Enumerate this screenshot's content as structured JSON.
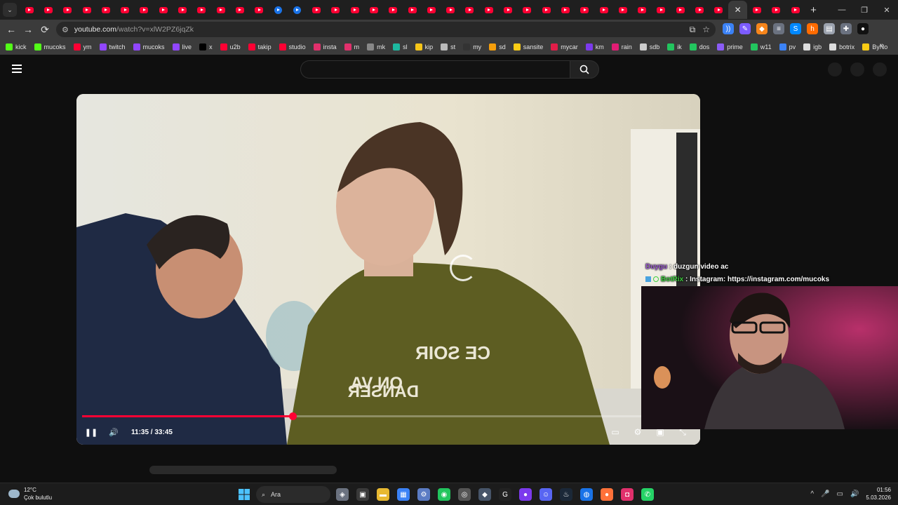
{
  "browser": {
    "tab_count": 41,
    "active_tab_index": 37,
    "blue_tab_indices": [
      13,
      14
    ],
    "close_glyph": "✕",
    "new_tab_glyph": "+",
    "window_controls": [
      "—",
      "❐",
      "✕"
    ],
    "nav": {
      "back": "←",
      "forward": "→",
      "reload": "⟳"
    },
    "url_host": "youtube.com",
    "url_path": "/watch?v=xlW2PZ6jqZk",
    "extensions": [
      {
        "icon": "audio-wave-icon",
        "glyph": "))",
        "color": "#3b82f6"
      },
      {
        "icon": "pen-icon",
        "glyph": "✎",
        "color": "#7c5cff"
      },
      {
        "icon": "metamask-icon",
        "glyph": "◆",
        "color": "#f6851b"
      },
      {
        "icon": "database-icon",
        "glyph": "≡",
        "color": "#6b7280"
      },
      {
        "icon": "shazam-icon",
        "glyph": "S",
        "color": "#0088ff"
      },
      {
        "icon": "honey-icon",
        "glyph": "h",
        "color": "#ff6b00"
      },
      {
        "icon": "wallet-icon",
        "glyph": "▤",
        "color": "#9ca3af"
      },
      {
        "icon": "puzzle-icon",
        "glyph": "✚",
        "color": "#6b7280"
      },
      {
        "icon": "profile-icon",
        "glyph": "●",
        "color": "#111111"
      }
    ]
  },
  "bookmarks": [
    {
      "label": "kick",
      "color": "#53fc18"
    },
    {
      "label": "mucoks",
      "color": "#53fc18"
    },
    {
      "label": "ym",
      "color": "#ff0033"
    },
    {
      "label": "twitch",
      "color": "#9146ff"
    },
    {
      "label": "mucoks",
      "color": "#9146ff"
    },
    {
      "label": "live",
      "color": "#9146ff"
    },
    {
      "label": "x",
      "color": "#000000"
    },
    {
      "label": "u2b",
      "color": "#ff0033"
    },
    {
      "label": "takip",
      "color": "#ff0033"
    },
    {
      "label": "studio",
      "color": "#ff0033"
    },
    {
      "label": "insta",
      "color": "#e1306c"
    },
    {
      "label": "m",
      "color": "#e1306c"
    },
    {
      "label": "mk",
      "color": "#888888"
    },
    {
      "label": "sl",
      "color": "#1db9a0"
    },
    {
      "label": "kip",
      "color": "#f5c518"
    },
    {
      "label": "st",
      "color": "#bbbbbb"
    },
    {
      "label": "my",
      "color": "#333333"
    },
    {
      "label": "sd",
      "color": "#f59e0b"
    },
    {
      "label": "sansite",
      "color": "#facc15"
    },
    {
      "label": "mycar",
      "color": "#e11d48"
    },
    {
      "label": "km",
      "color": "#7c3aed"
    },
    {
      "label": "rain",
      "color": "#e11d74"
    },
    {
      "label": "sdb",
      "color": "#cccccc"
    },
    {
      "label": "ik",
      "color": "#22c55e"
    },
    {
      "label": "dos",
      "color": "#22c55e"
    },
    {
      "label": "prime",
      "color": "#8b5cf6"
    },
    {
      "label": "w11",
      "color": "#22c55e"
    },
    {
      "label": "pv",
      "color": "#3b82f6"
    },
    {
      "label": "igb",
      "color": "#dddddd"
    },
    {
      "label": "botrix",
      "color": "#dddddd"
    },
    {
      "label": "ByNo",
      "color": "#facc15"
    }
  ],
  "bookmarks_more": "»",
  "video": {
    "current_time": "11:35",
    "duration": "33:45",
    "progress_fraction": 0.3437,
    "controls": {
      "play_pause": "❚❚",
      "volume": "🔊",
      "subtitles": "▭",
      "settings": "⚙",
      "miniplayer": "▣",
      "fullscreen": "⤡"
    }
  },
  "overlay": {
    "chat": [
      {
        "user": "Duygu",
        "message": "duzgun video ac",
        "kind": "u1"
      },
      {
        "user": "BotRix",
        "message": "Instagram: https://instagram.com/mucoks",
        "kind": "u2"
      }
    ]
  },
  "taskbar": {
    "temperature": "12°C",
    "condition": "Çok bulutlu",
    "search_placeholder": "Ara",
    "time": "01:56",
    "date": "5.03.2026",
    "tray": [
      "^",
      "🎤",
      "▭",
      "🔊"
    ],
    "apps": [
      {
        "icon": "widgets-icon",
        "glyph": "◈",
        "color": "#6b7280"
      },
      {
        "icon": "task-view-icon",
        "glyph": "▣",
        "color": "#3a3a3a"
      },
      {
        "icon": "file-explorer-icon",
        "glyph": "▬",
        "color": "#e8b931"
      },
      {
        "icon": "store-icon",
        "glyph": "▦",
        "color": "#3b82f6"
      },
      {
        "icon": "settings-app-icon",
        "glyph": "⚙",
        "color": "#5b7cc4"
      },
      {
        "icon": "razer-icon",
        "glyph": "◉",
        "color": "#22c55e"
      },
      {
        "icon": "steelseries-icon",
        "glyph": "◎",
        "color": "#555555"
      },
      {
        "icon": "wallet-app-icon",
        "glyph": "◆",
        "color": "#475569"
      },
      {
        "icon": "g-hub-icon",
        "glyph": "G",
        "color": "#222222"
      },
      {
        "icon": "obs-icon",
        "glyph": "●",
        "color": "#7c3aed"
      },
      {
        "icon": "discord-icon",
        "glyph": "☺",
        "color": "#5865f2"
      },
      {
        "icon": "steam-icon",
        "glyph": "♨",
        "color": "#1b2838"
      },
      {
        "icon": "chrome-icon",
        "glyph": "◍",
        "color": "#1a73e8"
      },
      {
        "icon": "firefox-icon",
        "glyph": "●",
        "color": "#ff7139"
      },
      {
        "icon": "instagram-icon",
        "glyph": "◘",
        "color": "#e1306c"
      },
      {
        "icon": "whatsapp-icon",
        "glyph": "✆",
        "color": "#25d366"
      }
    ]
  }
}
